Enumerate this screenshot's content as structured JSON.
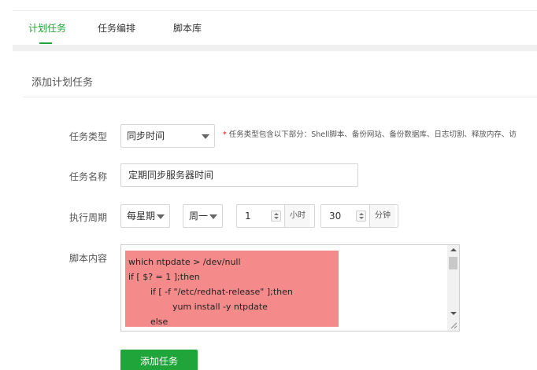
{
  "tabs": [
    {
      "label": "计划任务",
      "active": true
    },
    {
      "label": "任务编排",
      "active": false
    },
    {
      "label": "脚本库",
      "active": false
    }
  ],
  "panel": {
    "title": "添加计划任务"
  },
  "form": {
    "task_type": {
      "label": "任务类型",
      "value": "同步时间",
      "hint": "任务类型包含以下部分：Shell脚本、备份网站、备份数据库、日志切割、释放内存、访",
      "hint_mark": "*"
    },
    "task_name": {
      "label": "任务名称",
      "value": "定期同步服务器时间"
    },
    "cycle": {
      "label": "执行周期",
      "period": "每星期",
      "weekday": "周一",
      "hour_value": "1",
      "hour_unit": "小时",
      "minute_value": "30",
      "minute_unit": "分钟"
    },
    "script": {
      "label": "脚本内容",
      "code": "which ntpdate > /dev/null\nif [ $? = 1 ];then\n        if [ -f \"/etc/redhat-release\" ];then\n                yum install -y ntpdate\n        else"
    },
    "submit_label": "添加任务"
  },
  "colors": {
    "accent": "#20a53a",
    "highlight": "#f48a8a",
    "required": "#ef0808"
  }
}
